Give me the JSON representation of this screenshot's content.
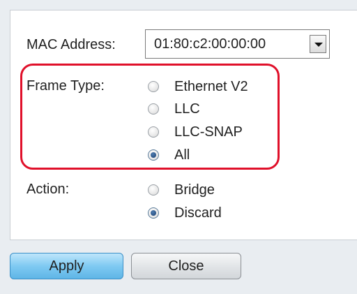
{
  "form": {
    "mac_address_label": "MAC Address:",
    "mac_address_value": "01:80:c2:00:00:00",
    "frame_type_label": "Frame Type:",
    "frame_type_options": [
      {
        "label": "Ethernet V2",
        "checked": false
      },
      {
        "label": "LLC",
        "checked": false
      },
      {
        "label": "LLC-SNAP",
        "checked": false
      },
      {
        "label": "All",
        "checked": true
      }
    ],
    "action_label": "Action:",
    "action_options": [
      {
        "label": "Bridge",
        "checked": false
      },
      {
        "label": "Discard",
        "checked": true
      }
    ]
  },
  "buttons": {
    "apply_label": "Apply",
    "close_label": "Close"
  },
  "colors": {
    "highlight": "#e0102a",
    "apply_button": "#7fcaf2",
    "background": "#e9edf1"
  },
  "icons": {
    "select_arrow": "chevron-down-icon",
    "radio": "radio-button-icon"
  }
}
